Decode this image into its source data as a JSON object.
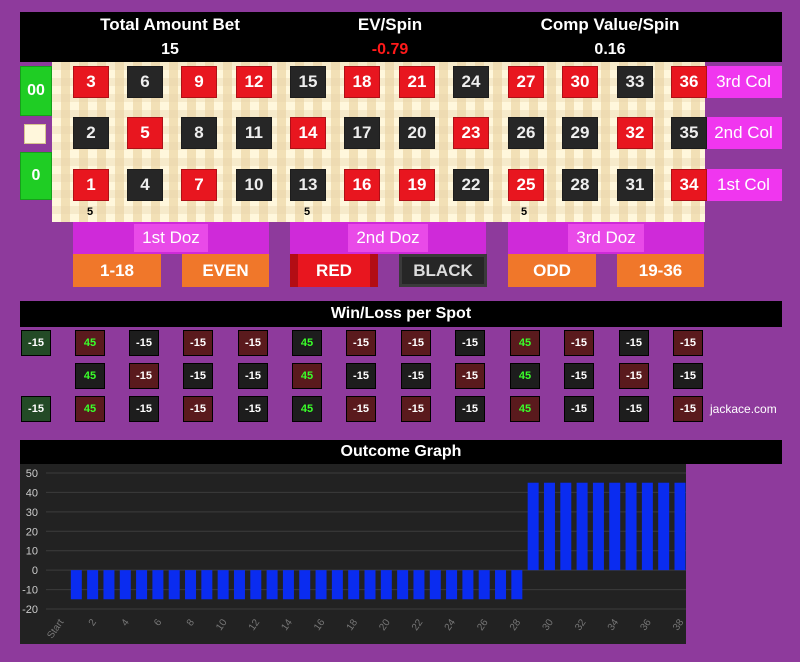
{
  "header": {
    "total_bet_label": "Total Amount Bet",
    "total_bet_value": "15",
    "ev_label": "EV/Spin",
    "ev_value": "-0.79",
    "comp_label": "Comp Value/Spin",
    "comp_value": "0.16"
  },
  "colors": {
    "red": "#e8161f",
    "black": "#262626",
    "green": "#1fcd24",
    "outside_bet": "#f0772a",
    "column_bet": "#f036ef",
    "bar": "#0a2cf0",
    "ev_negative": "#ff1a1a"
  },
  "zeros": [
    "00",
    "0"
  ],
  "rows": [
    {
      "numbers": [
        "3",
        "6",
        "9",
        "12",
        "15",
        "18",
        "21",
        "24",
        "27",
        "30",
        "33",
        "36"
      ],
      "colors": [
        "red",
        "black",
        "red",
        "red",
        "black",
        "red",
        "red",
        "black",
        "red",
        "red",
        "black",
        "red"
      ],
      "column_label": "3rd Col"
    },
    {
      "numbers": [
        "2",
        "5",
        "8",
        "11",
        "14",
        "17",
        "20",
        "23",
        "26",
        "29",
        "32",
        "35"
      ],
      "colors": [
        "black",
        "red",
        "black",
        "black",
        "red",
        "black",
        "black",
        "red",
        "black",
        "black",
        "red",
        "black"
      ],
      "column_label": "2nd Col"
    },
    {
      "numbers": [
        "1",
        "4",
        "7",
        "10",
        "13",
        "16",
        "19",
        "22",
        "25",
        "28",
        "31",
        "34"
      ],
      "colors": [
        "red",
        "black",
        "red",
        "black",
        "black",
        "red",
        "red",
        "black",
        "red",
        "black",
        "black",
        "red"
      ],
      "column_label": "1st Col"
    }
  ],
  "chips": [
    "5",
    "5",
    "5"
  ],
  "dozens": [
    "1st Doz",
    "2nd Doz",
    "3rd Doz"
  ],
  "outside_bets": [
    "1-18",
    "EVEN",
    "RED",
    "BLACK",
    "ODD",
    "19-36"
  ],
  "winloss": {
    "title": "Win/Loss per Spot",
    "zeros": [
      "-15",
      "",
      "-15"
    ],
    "rows": [
      [
        "45",
        "-15",
        "-15",
        "-15",
        "45",
        "-15",
        "-15",
        "-15",
        "45",
        "-15",
        "-15",
        "-15"
      ],
      [
        "45",
        "-15",
        "-15",
        "-15",
        "45",
        "-15",
        "-15",
        "-15",
        "45",
        "-15",
        "-15",
        "-15"
      ],
      [
        "45",
        "-15",
        "-15",
        "-15",
        "45",
        "-15",
        "-15",
        "-15",
        "45",
        "-15",
        "-15",
        "-15"
      ]
    ],
    "watermark": "jackace.com"
  },
  "graph": {
    "title": "Outcome Graph",
    "y_ticks": [
      "50",
      "40",
      "30",
      "20",
      "10",
      "0",
      "-10",
      "-20"
    ],
    "x_ticks": [
      "Start",
      "2",
      "4",
      "6",
      "8",
      "10",
      "12",
      "14",
      "16",
      "18",
      "20",
      "22",
      "24",
      "26",
      "28",
      "30",
      "32",
      "34",
      "36",
      "38"
    ]
  },
  "chart_data": {
    "type": "bar",
    "title": "Outcome Graph",
    "ylim": [
      -20,
      50
    ],
    "x": [
      "Start",
      "1",
      "2",
      "3",
      "4",
      "5",
      "6",
      "7",
      "8",
      "9",
      "10",
      "11",
      "12",
      "13",
      "14",
      "15",
      "16",
      "17",
      "18",
      "19",
      "20",
      "21",
      "22",
      "23",
      "24",
      "25",
      "26",
      "27",
      "28",
      "29",
      "30",
      "31",
      "32",
      "33",
      "34",
      "35",
      "36",
      "37",
      "38"
    ],
    "values": [
      null,
      -15,
      -15,
      -15,
      -15,
      -15,
      -15,
      -15,
      -15,
      -15,
      -15,
      -15,
      -15,
      -15,
      -15,
      -15,
      -15,
      -15,
      -15,
      -15,
      -15,
      -15,
      -15,
      -15,
      -15,
      -15,
      -15,
      -15,
      -15,
      45,
      45,
      45,
      45,
      45,
      45,
      45,
      45,
      45,
      45
    ]
  }
}
